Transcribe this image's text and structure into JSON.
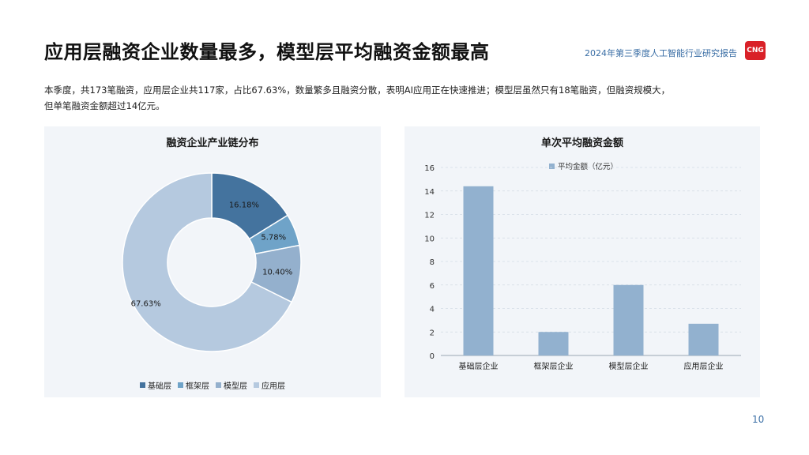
{
  "header": {
    "title": "应用层融资企业数量最多，模型层平均融资金额最高",
    "report_name": "2024年第三季度人工智能行业研究报告",
    "logo_text": "CNG",
    "logo_color": "#d92128"
  },
  "summary": {
    "line1": "本季度，共173笔融资，应用层企业共117家，占比67.63%，数量繁多且融资分散，表明AI应用正在快速推进；模型层虽然只有18笔融资，但融资规模大，",
    "line2": "但单笔融资金额超过14亿元。"
  },
  "chart_data": [
    {
      "type": "pie",
      "title": "融资企业产业链分布",
      "donut": true,
      "categories": [
        "基础层",
        "框架层",
        "模型层",
        "应用层"
      ],
      "values": [
        16.18,
        5.78,
        10.4,
        67.63
      ],
      "labels": [
        "16.18%",
        "5.78%",
        "10.40%",
        "67.63%"
      ],
      "colors": [
        "#44739e",
        "#6fa3c8",
        "#94b0cd",
        "#b5c9df"
      ],
      "legend": "bottom"
    },
    {
      "type": "bar",
      "title": "单次平均融资金额",
      "categories": [
        "基础层企业",
        "框架层企业",
        "模型层企业",
        "应用层企业"
      ],
      "series": [
        {
          "name": "平均金额（亿元）",
          "values": [
            14.4,
            2.0,
            6.0,
            2.7
          ]
        }
      ],
      "ylim": [
        0,
        16
      ],
      "yticks": [
        "0",
        "2",
        "4",
        "6",
        "8",
        "10",
        "12",
        "14",
        "16"
      ],
      "grid": true,
      "legend": "top",
      "color": "#92b1cf"
    }
  ],
  "page_number": "10"
}
